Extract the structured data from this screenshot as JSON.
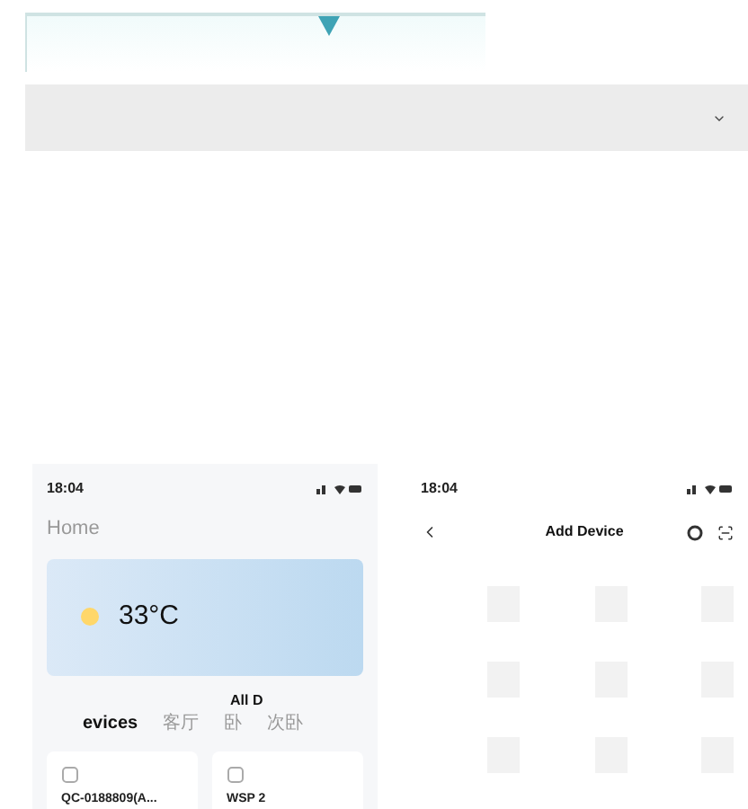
{
  "panel": {
    "expanded": false
  },
  "left_phone": {
    "time": "18:04",
    "home": "Home",
    "weather": {
      "temperature": "33°C"
    },
    "tabs": [
      {
        "label": "evices",
        "selected": true
      },
      {
        "label": "客厅",
        "selected": false
      },
      {
        "label": "卧",
        "selected": false
      },
      {
        "label": "次卧",
        "selected": false
      }
    ],
    "tab_overlay": "All D",
    "devices": [
      {
        "name": "QC-0188809(A..."
      },
      {
        "name": "WSP 2"
      }
    ]
  },
  "right_phone": {
    "time": "18:04",
    "title": "Add Device"
  }
}
